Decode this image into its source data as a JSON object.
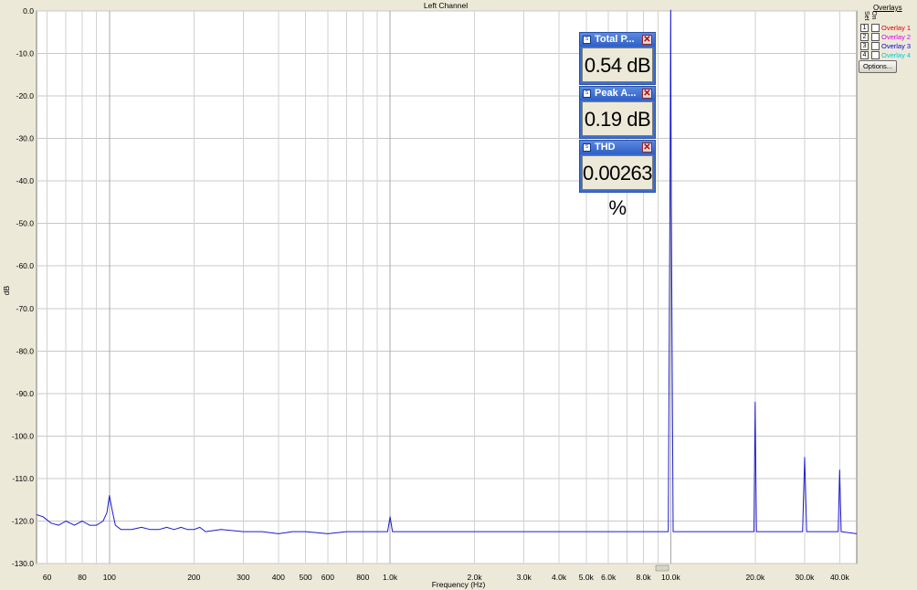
{
  "chart_data": {
    "type": "line",
    "title": "Left Channel",
    "xlabel": "Frequency (Hz)",
    "ylabel": "dB",
    "x_scale": "log",
    "xlim": [
      55,
      46000
    ],
    "ylim": [
      -130,
      0
    ],
    "grid": true,
    "yticks": [
      0,
      -10,
      -20,
      -30,
      -40,
      -50,
      -60,
      -70,
      -80,
      -90,
      -100,
      -110,
      -120,
      -130
    ],
    "ytick_labels": [
      "0.0",
      "-10.0",
      "-20.0",
      "-30.0",
      "-40.0",
      "-50.0",
      "-60.0",
      "-70.0",
      "-80.0",
      "-90.0",
      "-100.0",
      "-110.0",
      "-120.0",
      "-130.0"
    ],
    "xticks": [
      60,
      80,
      100,
      200,
      300,
      400,
      500,
      600,
      800,
      1000,
      2000,
      3000,
      4000,
      5000,
      6000,
      8000,
      10000,
      20000,
      30000,
      40000
    ],
    "xtick_labels": [
      "60",
      "80",
      "100",
      "200",
      "300",
      "400",
      "500",
      "600",
      "800",
      "1.0k",
      "2.0k",
      "3.0k",
      "4.0k",
      "5.0k",
      "6.0k",
      "8.0k",
      "10.0k",
      "20.0k",
      "30.0k",
      "40.0k"
    ],
    "series": [
      {
        "color": "#1c1ccc",
        "x": [
          55,
          58,
          62,
          66,
          70,
          75,
          80,
          85,
          90,
          95,
          98,
          100,
          102,
          105,
          110,
          120,
          130,
          140,
          150,
          160,
          170,
          180,
          190,
          200,
          210,
          220,
          250,
          300,
          350,
          400,
          450,
          500,
          600,
          700,
          800,
          900,
          980,
          1000,
          1020,
          1200,
          1500,
          2000,
          2500,
          3000,
          4000,
          5000,
          6000,
          7000,
          8000,
          9000,
          9800,
          9950,
          10000,
          10050,
          10200,
          12000,
          15000,
          18000,
          19800,
          20000,
          20200,
          25000,
          29500,
          30000,
          30500,
          35000,
          39500,
          40000,
          40500,
          46000
        ],
        "values": [
          -118.5,
          -119,
          -120.5,
          -121,
          -120,
          -121,
          -120,
          -121,
          -121,
          -120,
          -118,
          -114,
          -117,
          -121,
          -122,
          -122,
          -121.5,
          -122,
          -122,
          -121.5,
          -122,
          -121.5,
          -122,
          -122,
          -121.5,
          -122.5,
          -122,
          -122.5,
          -122.5,
          -123,
          -122.5,
          -122.5,
          -123,
          -122.5,
          -122.5,
          -122.5,
          -122.5,
          -119,
          -122.5,
          -122.5,
          -122.5,
          -122.5,
          -122.5,
          -122.5,
          -122.5,
          -122.5,
          -122.5,
          -122.5,
          -122.5,
          -122.5,
          -122.5,
          -35,
          0.19,
          -45,
          -122.5,
          -122.5,
          -122.5,
          -122.5,
          -122.5,
          -92,
          -122.5,
          -122.5,
          -122.5,
          -105,
          -122.5,
          -122.5,
          -122.5,
          -108,
          -122.5,
          -123
        ]
      }
    ]
  },
  "meters": [
    {
      "title": "Total P...",
      "value": "0.54 dB"
    },
    {
      "title": "Peak A...",
      "value": "0.19 dB"
    },
    {
      "title": "THD",
      "value": "0.00263 %"
    }
  ],
  "overlays": {
    "title": "Overlays",
    "col_set": "Set",
    "col_on": "On",
    "items": [
      {
        "num": "1",
        "label": "Overlay 1",
        "color": "#e00000"
      },
      {
        "num": "2",
        "label": "Overlay 2",
        "color": "#e000e0"
      },
      {
        "num": "3",
        "label": "Overlay 3",
        "color": "#0000e0"
      },
      {
        "num": "4",
        "label": "Overlay 4",
        "color": "#00c8d8"
      }
    ],
    "options_label": "Options..."
  }
}
